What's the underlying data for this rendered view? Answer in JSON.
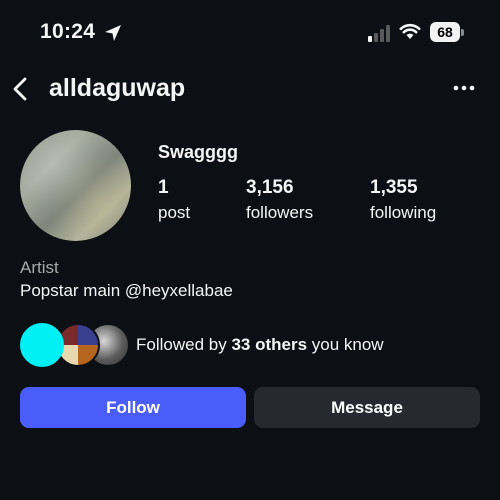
{
  "status_bar": {
    "time": "10:24",
    "battery": "68",
    "icons": [
      "location-arrow-icon",
      "cellular-signal-icon",
      "wifi-icon",
      "battery-icon"
    ]
  },
  "header": {
    "username": "alldaguwap",
    "icons": [
      "back-chevron-icon",
      "more-options-icon"
    ]
  },
  "profile": {
    "display_name": "Swagggg",
    "stats": [
      {
        "value": "1",
        "label": "post"
      },
      {
        "value": "3,156",
        "label": "followers"
      },
      {
        "value": "1,355",
        "label": "following"
      }
    ],
    "category": "Artist",
    "bio": "Popstar main @heyxellabae"
  },
  "followed_by": {
    "prefix": "Followed by ",
    "count_text": "33 others",
    "suffix": " you know",
    "avatar_colors": [
      "#00f0f5",
      "#7a4a2c",
      "#8a8a8a"
    ]
  },
  "actions": {
    "follow_label": "Follow",
    "message_label": "Message",
    "follow_color": "#4a5df9",
    "message_color": "#262a30"
  },
  "colors": {
    "background": "#0c1014",
    "text": "#f5f5f5",
    "muted_text": "#a8a8a8"
  }
}
